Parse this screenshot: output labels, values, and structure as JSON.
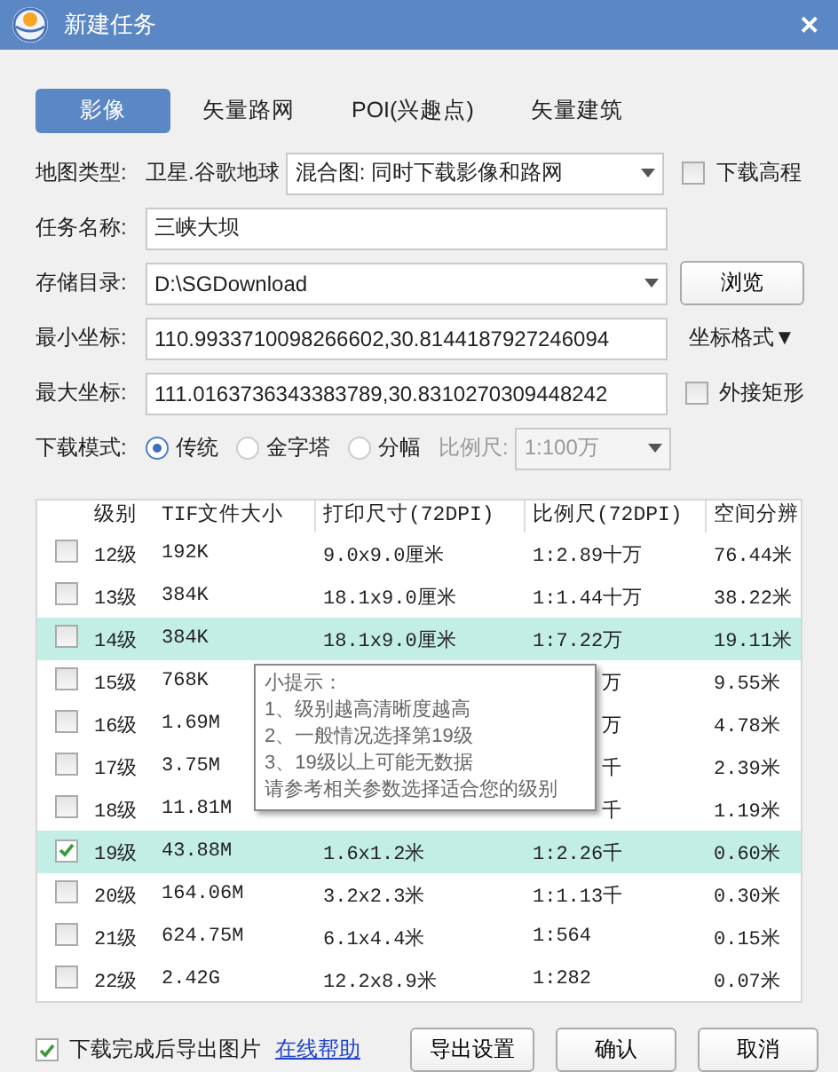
{
  "window": {
    "title": "新建任务",
    "close": "✕"
  },
  "tabs": [
    {
      "label": "影像",
      "selected": true
    },
    {
      "label": "矢量路网",
      "selected": false
    },
    {
      "label": "POI(兴趣点)",
      "selected": false
    },
    {
      "label": "矢量建筑",
      "selected": false
    }
  ],
  "map_type": {
    "label": "地图类型:",
    "source": "卫星.谷歌地球",
    "value": "混合图: 同时下载影像和路网",
    "elevation": {
      "label": "下载高程",
      "checked": false
    }
  },
  "task_name": {
    "label": "任务名称:",
    "value": "三峡大坝"
  },
  "directory": {
    "label": "存储目录:",
    "value": "D:\\SGDownload",
    "browse": "浏览"
  },
  "min_coord": {
    "label": "最小坐标:",
    "value": "110.9933710098266602,30.8144187927246094",
    "format": "坐标格式▼"
  },
  "max_coord": {
    "label": "最大坐标:",
    "value": "111.0163736343383789,30.8310270309448242",
    "bounding": {
      "label": "外接矩形",
      "checked": false
    }
  },
  "mode": {
    "label": "下载模式:",
    "options": [
      {
        "label": "传统",
        "selected": true
      },
      {
        "label": "金字塔",
        "selected": false
      },
      {
        "label": "分幅",
        "selected": false
      }
    ],
    "scale_label": "比例尺:",
    "scale_value": "1:100万"
  },
  "table": {
    "columns": [
      "级别",
      "TIF文件大小",
      "打印尺寸(72DPI)",
      "比例尺(72DPI)",
      "空间分辨"
    ],
    "rows": [
      {
        "level": "12级",
        "size": "192K",
        "print": "9.0x9.0厘米",
        "scale": "1:2.89十万",
        "res": "76.44米",
        "checked": false,
        "selected": false
      },
      {
        "level": "13级",
        "size": "384K",
        "print": "18.1x9.0厘米",
        "scale": "1:1.44十万",
        "res": "38.22米",
        "checked": false,
        "selected": false
      },
      {
        "level": "14级",
        "size": "384K",
        "print": "18.1x9.0厘米",
        "scale": "1:7.22万",
        "res": "19.11米",
        "checked": false,
        "selected": true
      },
      {
        "level": "15级",
        "size": "768K",
        "scale": "万",
        "res": "9.55米",
        "checked": false,
        "selected": false
      },
      {
        "level": "16级",
        "size": "1.69M",
        "scale": "万",
        "res": "4.78米",
        "checked": false,
        "selected": false
      },
      {
        "level": "17级",
        "size": "3.75M",
        "scale": "千",
        "res": "2.39米",
        "checked": false,
        "selected": false
      },
      {
        "level": "18级",
        "size": "11.81M",
        "scale": "千",
        "res": "1.19米",
        "checked": false,
        "selected": false
      },
      {
        "level": "19级",
        "size": "43.88M",
        "print": "1.6x1.2米",
        "scale": "1:2.26千",
        "res": "0.60米",
        "checked": true,
        "selected": true
      },
      {
        "level": "20级",
        "size": "164.06M",
        "print": "3.2x2.3米",
        "scale": "1:1.13千",
        "res": "0.30米",
        "checked": false,
        "selected": false
      },
      {
        "level": "21级",
        "size": "624.75M",
        "print": "6.1x4.4米",
        "scale": "1:564",
        "res": "0.15米",
        "checked": false,
        "selected": false
      },
      {
        "level": "22级",
        "size": "2.42G",
        "print": "12.2x8.9米",
        "scale": "1:282",
        "res": "0.07米",
        "checked": false,
        "selected": false
      }
    ]
  },
  "tooltip": {
    "lines": [
      "小提示：",
      "1、级别越高清晰度越高",
      "2、一般情况选择第19级",
      "3、19级以上可能无数据",
      "请参考相关参数选择适合您的级别"
    ]
  },
  "footer": {
    "export": {
      "label": "下载完成后导出图片",
      "checked": true
    },
    "help": "在线帮助",
    "buttons": [
      "导出设置",
      "确认",
      "取消"
    ]
  }
}
